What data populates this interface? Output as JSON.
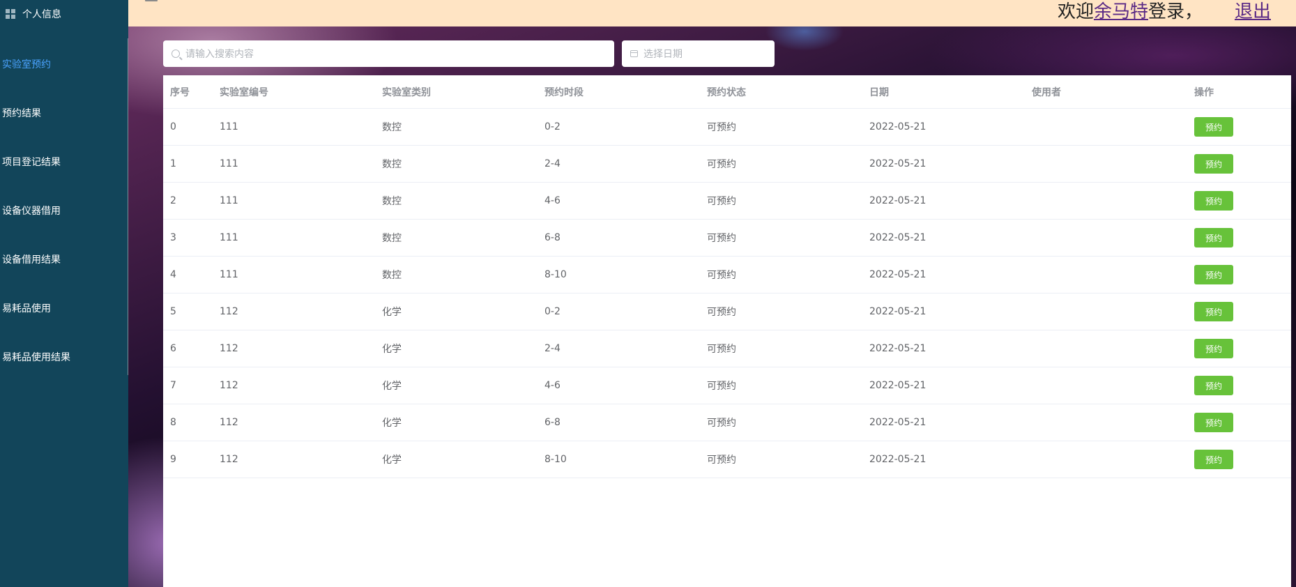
{
  "sidebar": {
    "top_label": "个人信息",
    "items": [
      {
        "label": "实验室预约",
        "active": true
      },
      {
        "label": "预约结果"
      },
      {
        "label": "项目登记结果"
      },
      {
        "label": "设备仪器借用"
      },
      {
        "label": "设备借用结果"
      },
      {
        "label": "易耗品使用"
      },
      {
        "label": "易耗品使用结果"
      }
    ],
    "active_color": "#4aa3ff",
    "bg_color": "#12455a"
  },
  "header": {
    "welcome_prefix": "欢迎",
    "username": "余马特",
    "welcome_suffix": "登录，",
    "logout": "退出",
    "bg_color": "#ffe4c4"
  },
  "search": {
    "placeholder": "请输入搜索内容",
    "date_placeholder": "选择日期"
  },
  "table": {
    "columns": [
      "序号",
      "实验室编号",
      "实验室类别",
      "预约时段",
      "预约状态",
      "日期",
      "使用者",
      "操作"
    ],
    "rows": [
      {
        "idx": "0",
        "lab_no": "111",
        "type": "数控",
        "slot": "0-2",
        "status": "可预约",
        "date": "2022-05-21",
        "user": "",
        "action": "预约"
      },
      {
        "idx": "1",
        "lab_no": "111",
        "type": "数控",
        "slot": "2-4",
        "status": "可预约",
        "date": "2022-05-21",
        "user": "",
        "action": "预约"
      },
      {
        "idx": "2",
        "lab_no": "111",
        "type": "数控",
        "slot": "4-6",
        "status": "可预约",
        "date": "2022-05-21",
        "user": "",
        "action": "预约"
      },
      {
        "idx": "3",
        "lab_no": "111",
        "type": "数控",
        "slot": "6-8",
        "status": "可预约",
        "date": "2022-05-21",
        "user": "",
        "action": "预约"
      },
      {
        "idx": "4",
        "lab_no": "111",
        "type": "数控",
        "slot": "8-10",
        "status": "可预约",
        "date": "2022-05-21",
        "user": "",
        "action": "预约"
      },
      {
        "idx": "5",
        "lab_no": "112",
        "type": "化学",
        "slot": "0-2",
        "status": "可预约",
        "date": "2022-05-21",
        "user": "",
        "action": "预约"
      },
      {
        "idx": "6",
        "lab_no": "112",
        "type": "化学",
        "slot": "2-4",
        "status": "可预约",
        "date": "2022-05-21",
        "user": "",
        "action": "预约"
      },
      {
        "idx": "7",
        "lab_no": "112",
        "type": "化学",
        "slot": "4-6",
        "status": "可预约",
        "date": "2022-05-21",
        "user": "",
        "action": "预约"
      },
      {
        "idx": "8",
        "lab_no": "112",
        "type": "化学",
        "slot": "6-8",
        "status": "可预约",
        "date": "2022-05-21",
        "user": "",
        "action": "预约"
      },
      {
        "idx": "9",
        "lab_no": "112",
        "type": "化学",
        "slot": "8-10",
        "status": "可预约",
        "date": "2022-05-21",
        "user": "",
        "action": "预约"
      }
    ],
    "action_color": "#67c23a"
  },
  "icons": {
    "sidebar_top": "grid-icon",
    "search": "search-icon",
    "date": "calendar-icon",
    "menu": "menu-icon"
  }
}
